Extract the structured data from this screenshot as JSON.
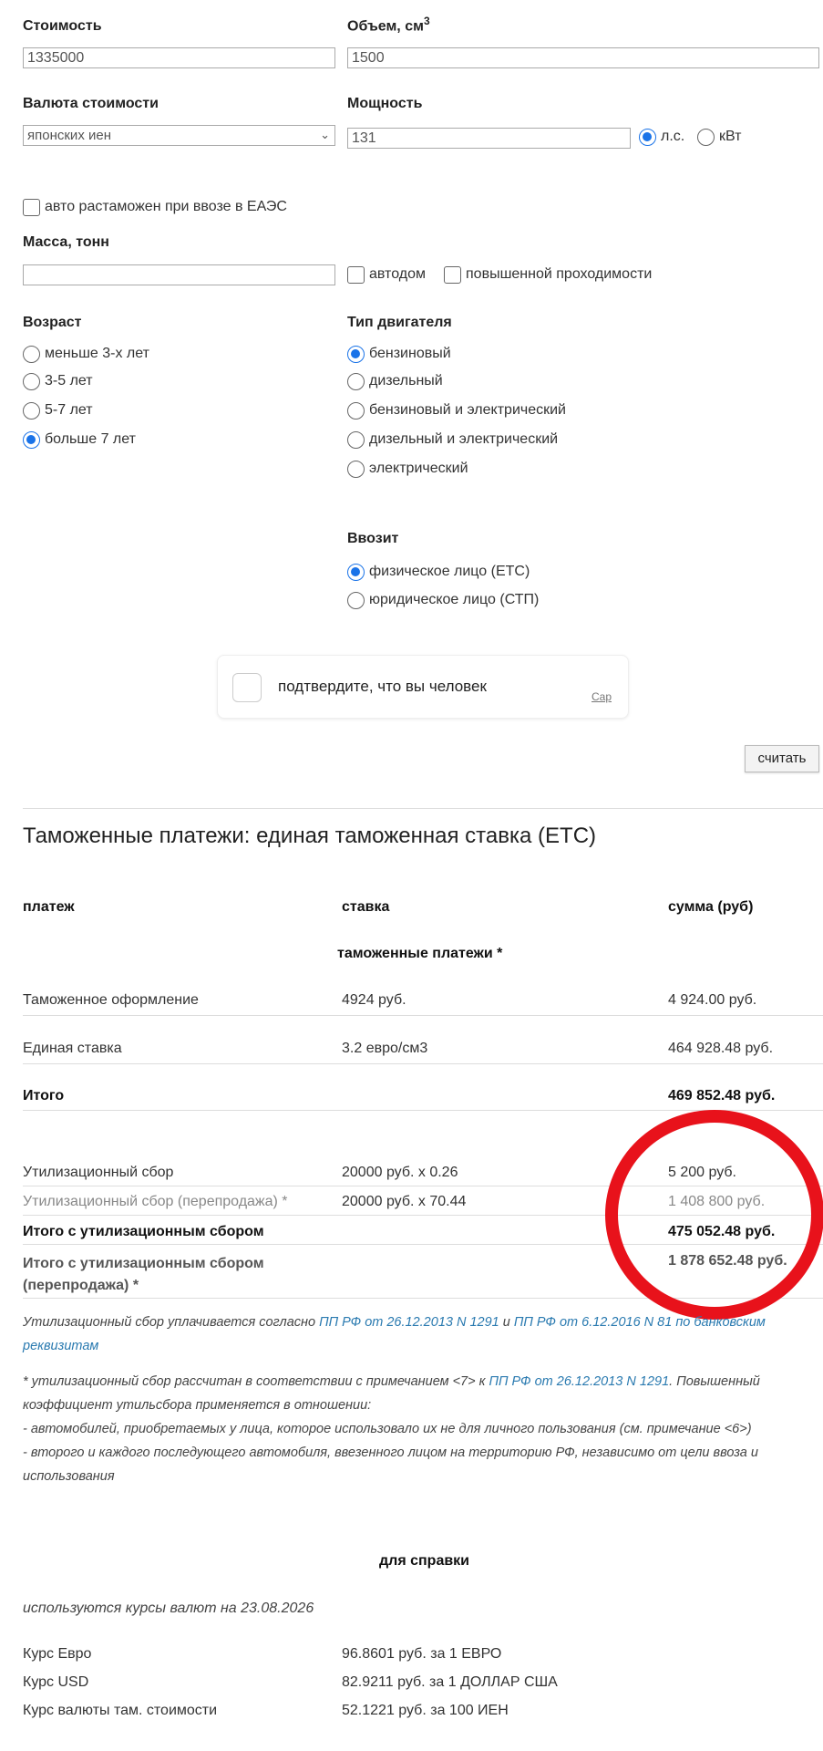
{
  "form": {
    "cost_label": "Стоимость",
    "cost_value": "1335000",
    "volume_label": "Объем, см",
    "volume_sup": "3",
    "volume_value": "1500",
    "currency_label": "Валюта стоимости",
    "currency_value": "японских иен",
    "power_label": "Мощность",
    "power_value": "131",
    "power_unit_hp": "л.с.",
    "power_unit_kw": "кВт",
    "eaes_label": "авто растаможен при ввозе в ЕАЭС",
    "mass_label": "Масса, тонн",
    "mass_value": "",
    "autohome_label": "автодом",
    "offroad_label": "повышенной проходимости",
    "age_label": "Возраст",
    "age_options": [
      "меньше 3-х лет",
      "3-5 лет",
      "5-7 лет",
      "больше 7 лет"
    ],
    "age_selected_index": 3,
    "engine_label": "Тип двигателя",
    "engine_options": [
      "бензиновый",
      "дизельный",
      "бензиновый и электрический",
      "дизельный и электрический",
      "электрический"
    ],
    "engine_selected_index": 0,
    "importer_label": "Ввозит",
    "importer_options": [
      "физическое лицо (ЕТС)",
      "юридическое лицо (СТП)"
    ],
    "importer_selected_index": 0,
    "captcha_text": "подтвердите, что вы человек",
    "captcha_brand": "Cap",
    "calc_button": "считать"
  },
  "results": {
    "title": "Таможенные платежи: единая таможенная ставка (ЕТС)",
    "col_payment": "платеж",
    "col_rate": "ставка",
    "col_sum": "сумма (руб)",
    "section_title": "таможенные платежи *",
    "rows": [
      {
        "payment": "Таможенное оформление",
        "rate": "4924 руб.",
        "sum": "4 924.00 руб."
      },
      {
        "payment": "Единая ставка",
        "rate": "3.2 евро/см3",
        "sum": "464 928.48 руб."
      }
    ],
    "total_label": "Итого",
    "total_sum": "469 852.48 руб.",
    "util_rows": [
      {
        "payment": "Утилизационный сбор",
        "rate": "20000 руб. x 0.26",
        "sum": "5 200 руб."
      },
      {
        "payment": "Утилизационный сбор (перепродажа) *",
        "rate": "20000 руб. x 70.44",
        "sum": "1 408 800 руб."
      }
    ],
    "total_util_label": "Итого с утилизационным сбором",
    "total_util_sum": "475 052.48 руб.",
    "total_util_resale_label_1": "Итого с утилизационным сбором",
    "total_util_resale_label_2": "(перепродажа) *",
    "total_util_resale_sum": "1 878 652.48 руб."
  },
  "notes": {
    "p1_a": "Утилизационный сбор уплачивается согласно ",
    "p1_link1": "ПП РФ от 26.12.2013 N 1291",
    "p1_b": " и ",
    "p1_link2": "ПП РФ от 6.12.2016 N 81 по банковским",
    "p1_link3": "реквизитам",
    "p2_a": "* утилизационный сбор рассчитан в соответствии с примечанием <7> к ",
    "p2_link": "ПП РФ от 26.12.2013 N 1291",
    "p2_b": ". Повышенный",
    "p2_line2": "коэффициент утильсбора применяется в отношении:",
    "p2_line3": "- автомобилей, приобретаемых у лица, которое использовало их не для личного пользования (см. примечание <6>)",
    "p2_line4": "- второго и каждого последующего автомобиля, ввезенного лицом на территорию РФ, независимо от цели ввоза и",
    "p2_line5": "использования"
  },
  "reference": {
    "title": "для справки",
    "rates_date": "используются курсы валют на 23.08.2026",
    "rows": [
      {
        "label": "Курс Евро",
        "value": "96.8601 руб. за 1 ЕВРО"
      },
      {
        "label": "Курс USD",
        "value": "82.9211 руб. за 1 ДОЛЛАР США"
      },
      {
        "label": "Курс валюты там. стоимости",
        "value": "52.1221 руб. за 100 ИЕН"
      }
    ]
  },
  "colors": {
    "accent": "#1a73e8",
    "link": "#2a7ab0",
    "highlight_ring": "#e8121b"
  }
}
